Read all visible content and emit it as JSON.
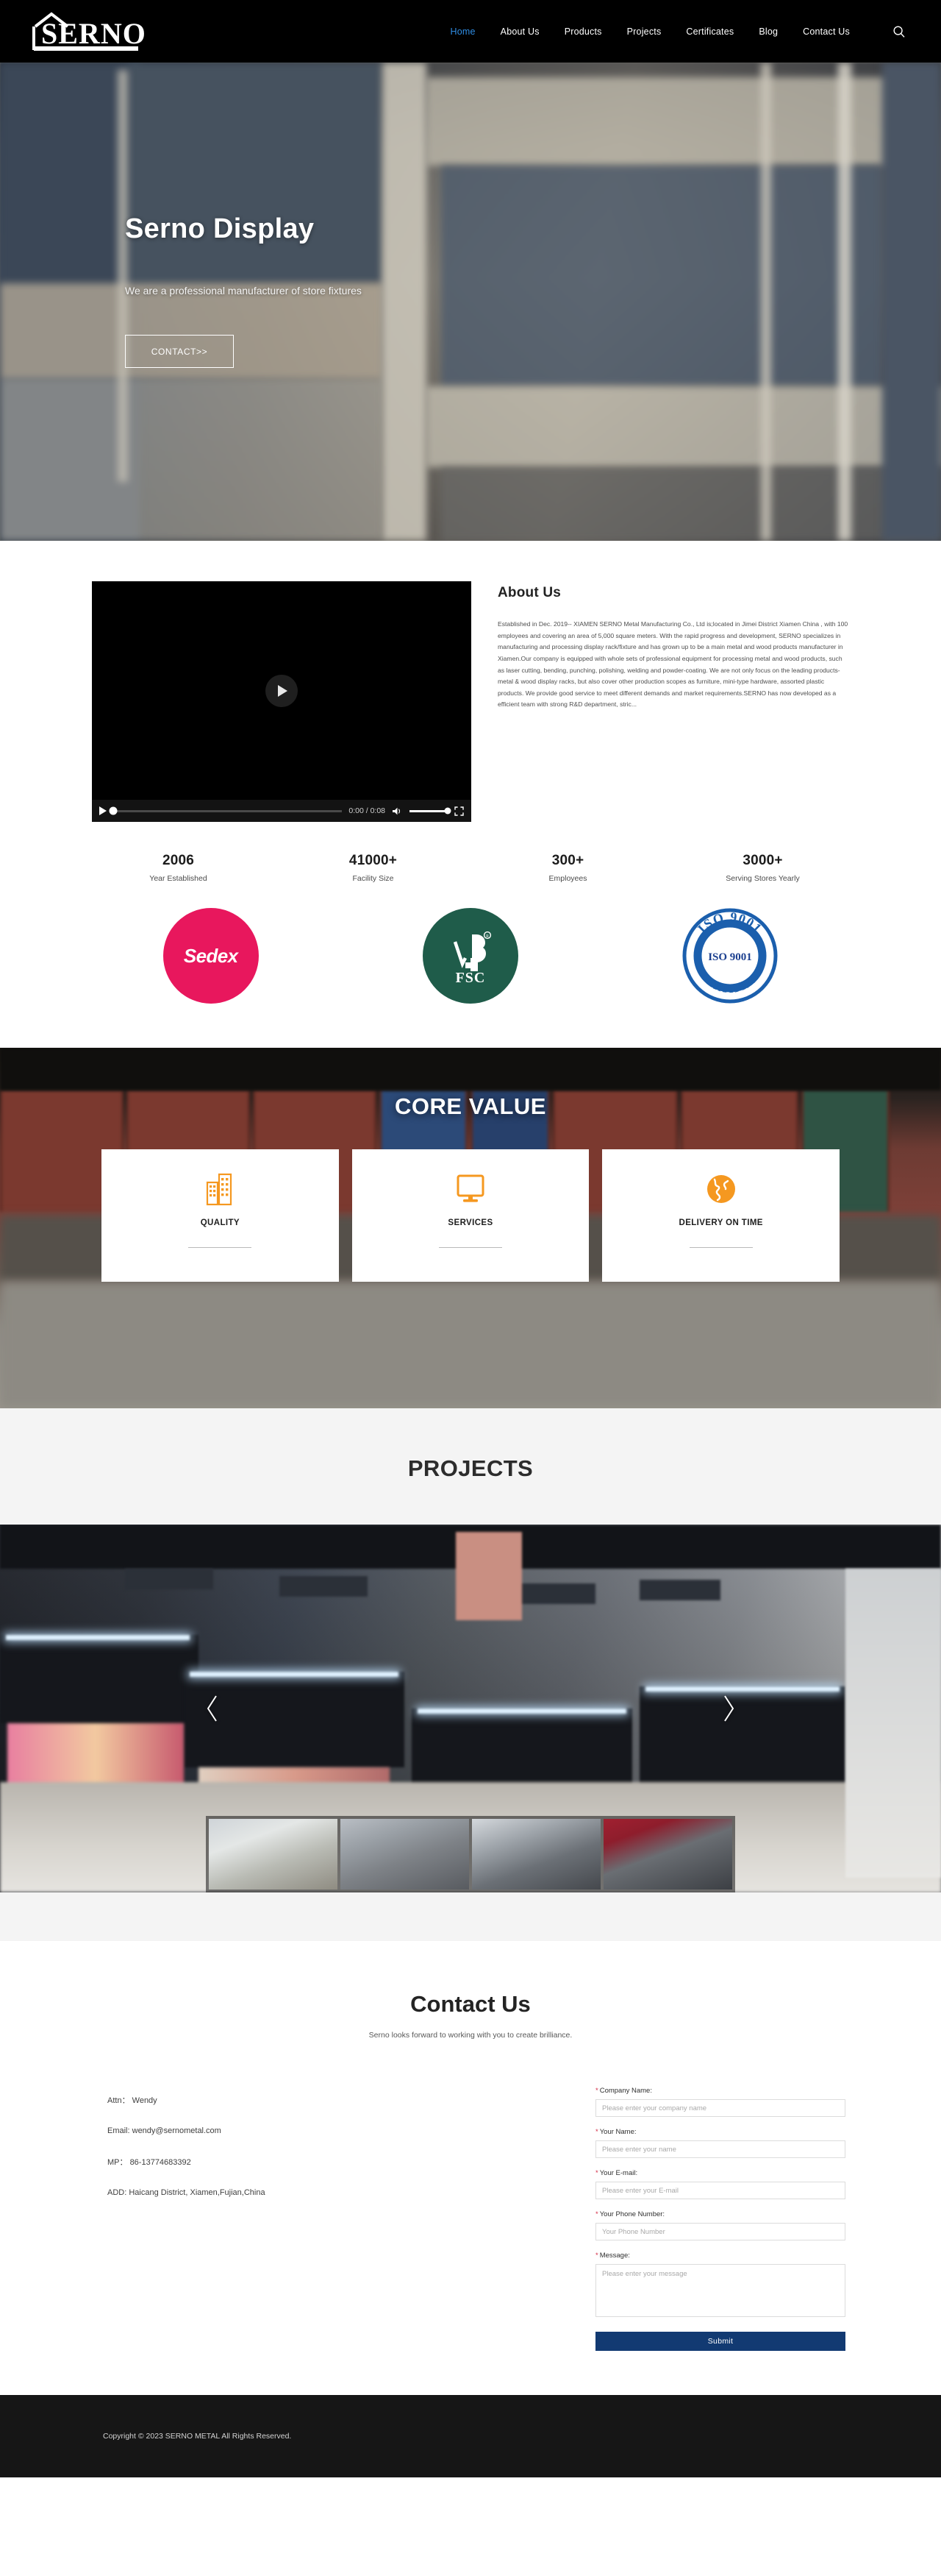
{
  "nav": {
    "logo_text": "SERNO",
    "logo_icon": "serno-house-logo",
    "search_icon": "search-icon",
    "items": [
      {
        "label": "Home",
        "active": true
      },
      {
        "label": "About Us",
        "active": false
      },
      {
        "label": "Products",
        "active": false
      },
      {
        "label": "Projects",
        "active": false
      },
      {
        "label": "Certificates",
        "active": false
      },
      {
        "label": "Blog",
        "active": false
      },
      {
        "label": "Contact Us",
        "active": false
      }
    ]
  },
  "hero": {
    "title": "Serno Display",
    "subtitle": "We are a professional manufacturer of store fixtures",
    "cta_label": "CONTACT>>"
  },
  "about": {
    "title": "About Us",
    "body": "Established in Dec. 2019-- XIAMEN SERNO Metal Manufacturing Co., Ltd is;located in Jimei District Xiamen China , with 100 employees and covering an area of 5,000 square meters. With the rapid progress and development, SERNO specializes in manufacturing and processing display rack/fixture and has grown up to be a main metal and wood products manufacturer in Xiamen.Our company is equipped with whole sets of professional equipment for processing metal and wood products, such as laser cutting, bending, punching, polishing, welding and powder-coating. We are not only focus on the leading products-metal & wood display racks, but also cover other production scopes as furniture, mini-type hardware, assorted plastic products. We provide good service to meet different demands and market requirements.SERNO has now developed as a efficient team with strong R&D department, stric...",
    "video": {
      "play_icon": "play-icon",
      "time_display": "0:00 / 0:08",
      "volume_icon": "volume-icon",
      "fullscreen_icon": "fullscreen-icon",
      "progress_percent": 0,
      "volume_percent": 100
    }
  },
  "stats": [
    {
      "value": "2006",
      "label": "Year Established"
    },
    {
      "value": "41000+",
      "label": "Facility Size"
    },
    {
      "value": "300+",
      "label": "Employees"
    },
    {
      "value": "3000+",
      "label": "Serving Stores Yearly"
    }
  ],
  "badges": [
    {
      "name": "Sedex",
      "icon": "sedex-badge",
      "color": "#e8175d"
    },
    {
      "name": "FSC",
      "icon": "fsc-badge",
      "color": "#1f5c4a"
    },
    {
      "name": "ISO 9001",
      "icon": "iso-9001-badge",
      "color": "#1b5fad",
      "sub": "CERTIFIED"
    }
  ],
  "core_value": {
    "heading": "CORE VALUE",
    "accent": "#f59820",
    "cards": [
      {
        "label": "QUALITY",
        "icon": "building-icon"
      },
      {
        "label": "SERVICES",
        "icon": "monitor-icon"
      },
      {
        "label": "DELIVERY ON TIME",
        "icon": "globe-icon"
      }
    ]
  },
  "projects": {
    "heading": "PROJECTS",
    "prev_icon": "chevron-left-icon",
    "next_icon": "chevron-right-icon",
    "thumbnails": [
      {
        "name": "project-thumbnail-1"
      },
      {
        "name": "project-thumbnail-2"
      },
      {
        "name": "project-thumbnail-3"
      },
      {
        "name": "project-thumbnail-4"
      }
    ]
  },
  "contact": {
    "title": "Contact Us",
    "subtitle": "Serno looks forward to working with you to create brilliance.",
    "info": [
      {
        "label": "Attn：",
        "value": "Wendy"
      },
      {
        "label": "Email:",
        "value": "wendy@sernometal.com"
      },
      {
        "label": "MP：",
        "value": "86-13774683392"
      },
      {
        "label": "ADD:",
        "value": "Haicang District, Xiamen,Fujian,China"
      }
    ],
    "form": {
      "required_mark": "*",
      "fields": [
        {
          "label": "Company Name:",
          "placeholder": "Please enter your company name",
          "value": "",
          "type": "text"
        },
        {
          "label": "Your Name:",
          "placeholder": "Please enter your name",
          "value": "",
          "type": "text"
        },
        {
          "label": "Your E-mail:",
          "placeholder": "Please enter your E-mail",
          "value": "",
          "type": "text"
        },
        {
          "label": "Your Phone Number:",
          "placeholder": "Your Phone Number",
          "value": "",
          "type": "text"
        },
        {
          "label": "Message:",
          "placeholder": "Please enter your message",
          "value": "",
          "type": "textarea"
        }
      ],
      "submit_label": "Submit",
      "submit_color": "#123a72"
    }
  },
  "footer": {
    "copyright": "Copyright © 2023 SERNO METAL All Rights Reserved."
  }
}
